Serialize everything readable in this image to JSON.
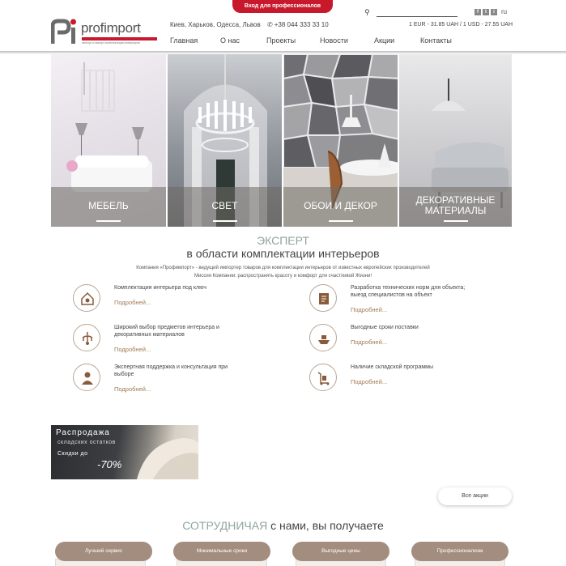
{
  "header": {
    "pro_login": "Вход для профессионалов",
    "brand": "profimport",
    "tagline": "экспорт и импорт комплектация интерьеров",
    "cities": "Киев, Харьков, Одесса, Львов",
    "phone": "+38 044 333 33 10",
    "search_placeholder": "",
    "social": [
      "f",
      "t",
      "i"
    ],
    "lang": "ru",
    "rates": "1 EUR - 31.85 UAH / 1 USD - 27.55 UAH",
    "nav": [
      "Главная",
      "О нас",
      "Проекты",
      "Новости",
      "Акции",
      "Контакты"
    ]
  },
  "tiles": [
    {
      "label": "Мебель"
    },
    {
      "label": "Свет"
    },
    {
      "label": "Обои и декор"
    },
    {
      "label_line1": "Декоративные",
      "label_line2": "материалы"
    }
  ],
  "expert": {
    "title": "ЭКСПЕРТ",
    "subtitle": "в области комплектации интерьеров",
    "desc_line1": "Компания «Профимпорт» - ведущий импортер товаров для комплектации интерьеров от известных европейских производителей",
    "desc_line2": "Миссия Компании: распространять красоту и комфорт для счастливой Жизни!",
    "more": "Подробней...",
    "features": [
      {
        "text": "Комплектация интерьера под ключ"
      },
      {
        "text": "Разработка технических норм для объекта; выезд специалистов на объект"
      },
      {
        "text": "Широкий выбор предметов интерьера и декоративных материалов"
      },
      {
        "text": "Выгодные сроки поставки"
      },
      {
        "text": "Экспертная поддержка и консультация при выборе"
      },
      {
        "text": "Наличие складской программы"
      }
    ]
  },
  "sale": {
    "line1": "Распродажа",
    "line2": "складских остатков",
    "line3": "Скидки до",
    "line4": "-70%"
  },
  "all_promos": "Все акции",
  "coop": {
    "highlight": "СОТРУДНИЧАЯ",
    "rest": " с нами, вы получаете",
    "pills": [
      "Лучший сервис",
      "Минимальные сроки",
      "Выгодные цены",
      "Профессионализм"
    ]
  },
  "colors": {
    "accent_red": "#c8182b",
    "accent_green": "#8fa69a",
    "brown": "#a38d7e"
  }
}
